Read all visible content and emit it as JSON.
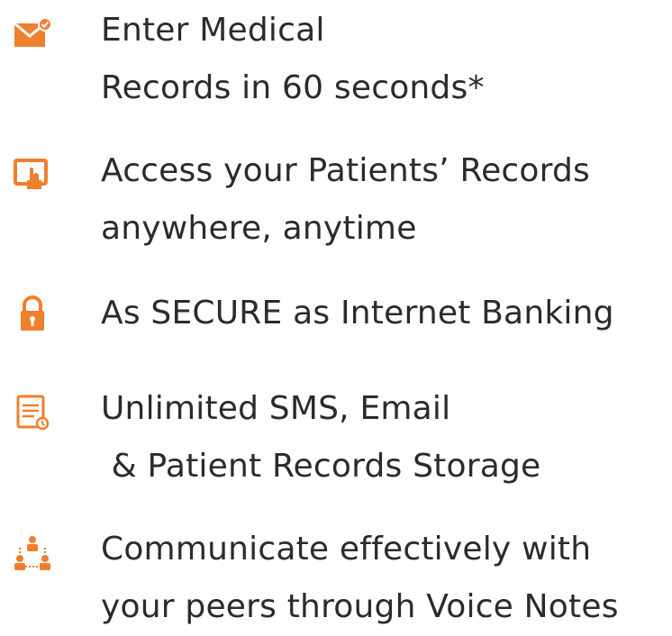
{
  "accent_color": "#f07f2d",
  "features": [
    {
      "icon": "envelope-check-icon",
      "lines": [
        "Enter Medical",
        "Records in 60 seconds*"
      ]
    },
    {
      "icon": "screen-touch-icon",
      "lines": [
        "Access your Patients’ Records",
        "anywhere, anytime"
      ]
    },
    {
      "icon": "lock-icon",
      "lines": [
        "As SECURE as Internet Banking"
      ]
    },
    {
      "icon": "records-storage-icon",
      "lines": [
        "Unlimited SMS, Email",
        " & Patient Records Storage"
      ]
    },
    {
      "icon": "peers-network-icon",
      "lines": [
        "Communicate effectively with",
        "your peers through Voice Notes"
      ]
    }
  ]
}
